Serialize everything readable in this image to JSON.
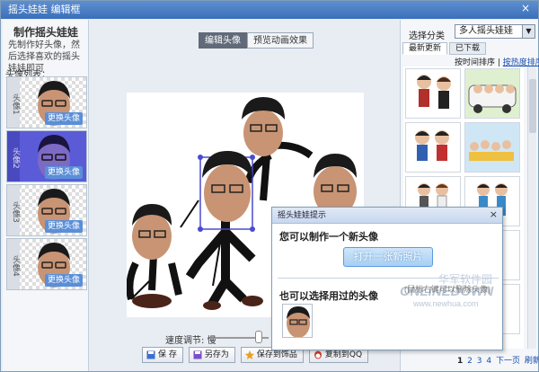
{
  "window": {
    "title": "摇头娃娃 编辑框",
    "close_glyph": "×"
  },
  "left_panel": {
    "title": "制作摇头娃娃",
    "description": "先制作好头像，然后选择喜欢的摇头娃娃即可",
    "avatar_list_label": "头像列表：",
    "avatars": [
      {
        "num": "头像1",
        "replace_label": "更换头像",
        "selected": false
      },
      {
        "num": "头像2",
        "replace_label": "更换头像",
        "selected": true
      },
      {
        "num": "头像3",
        "replace_label": "更换头像",
        "selected": false
      },
      {
        "num": "头像4",
        "replace_label": "更换头像",
        "selected": false
      }
    ]
  },
  "center": {
    "tabs": [
      {
        "label": "编辑头像",
        "active": true
      },
      {
        "label": "预览动画效果",
        "active": false
      }
    ],
    "speed_label": "速度调节: 慢",
    "buttons": [
      {
        "label": "保 存",
        "icon": "save-icon"
      },
      {
        "label": "另存为",
        "icon": "save-as-icon"
      },
      {
        "label": "保存到饰品",
        "icon": "accessory-icon"
      },
      {
        "label": "复制到QQ",
        "icon": "qq-icon"
      }
    ]
  },
  "right_panel": {
    "category_label": "选择分类",
    "category_value": "多人摇头娃娃",
    "tabs": [
      {
        "label": "最新更新",
        "active": true
      },
      {
        "label": "已下载",
        "active": false
      }
    ],
    "sort_plain": "按时间排序",
    "sort_sep": " | ",
    "sort_link": "按热度排序",
    "pager": [
      "1",
      "2",
      "3",
      "4"
    ],
    "pager_next": "下一页",
    "pager_refresh": "刷新"
  },
  "popup": {
    "title": "摇头娃娃提示",
    "close_glyph": "×",
    "text_new": "您可以制作一个新头像",
    "button_label": "打开一张新照片",
    "text_used": "也可以选择用过的头像"
  },
  "watermark": {
    "line1": "华军软件园",
    "line2": "ONLINEDOWN",
    "line3": "www.newhua.com",
    "line4": "(鼠标右键可以删除头像)"
  }
}
